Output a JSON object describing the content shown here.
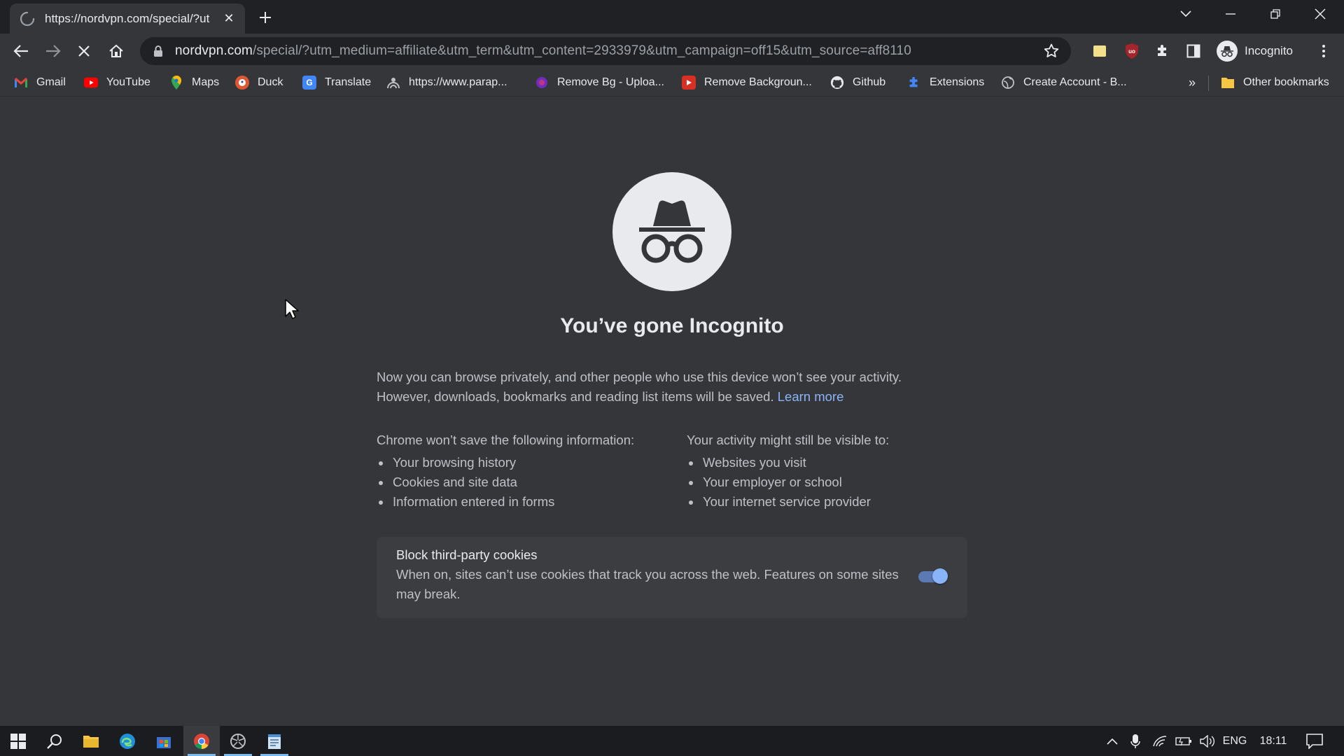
{
  "tab": {
    "title": "https://nordvpn.com/special/?ut",
    "close": "✕"
  },
  "newtab": "+",
  "toolbar": {
    "url_host": "nordvpn.com",
    "url_path": "/special/?utm_medium=affiliate&utm_term&utm_content=2933979&utm_campaign=off15&utm_source=aff8110",
    "profile_label": "Incognito"
  },
  "bookmarks": [
    {
      "label": "Gmail",
      "icon": "gmail-icon"
    },
    {
      "label": "YouTube",
      "icon": "youtube-icon"
    },
    {
      "label": "Maps",
      "icon": "maps-icon"
    },
    {
      "label": "Duck",
      "icon": "duck-icon"
    },
    {
      "label": "Translate",
      "icon": "translate-icon"
    },
    {
      "label": "https://www.parap...",
      "icon": "parap-icon"
    },
    {
      "label": "Remove Bg - Uploa...",
      "icon": "removebg-icon"
    },
    {
      "label": "Remove Backgroun...",
      "icon": "remove-background-icon"
    },
    {
      "label": "Github",
      "icon": "github-icon"
    },
    {
      "label": "Extensions",
      "icon": "extensions-icon"
    },
    {
      "label": "Create Account - B...",
      "icon": "globe-icon"
    }
  ],
  "bookmarks_overflow": "»",
  "other_bookmarks": "Other bookmarks",
  "page": {
    "heading": "You’ve gone Incognito",
    "intro_line1": "Now you can browse privately, and other people who use this device won’t see your activity.",
    "intro_line2": "However, downloads, bookmarks and reading list items will be saved.",
    "learn_more": "Learn more",
    "left_title": "Chrome won’t save the following information:",
    "left_items": [
      "Your browsing history",
      "Cookies and site data",
      "Information entered in forms"
    ],
    "right_title": "Your activity might still be visible to:",
    "right_items": [
      "Websites you visit",
      "Your employer or school",
      "Your internet service provider"
    ],
    "cookie_title": "Block third-party cookies",
    "cookie_desc": "When on, sites can’t use cookies that track you across the web. Features on some sites may break.",
    "cookie_toggle_on": true
  },
  "taskbar": {
    "language": "ENG",
    "time": "18:11"
  },
  "colors": {
    "background": "#35363a",
    "tabstrip": "#202124",
    "link": "#8ab4f8",
    "toggle_accent": "#8ab4f8"
  }
}
